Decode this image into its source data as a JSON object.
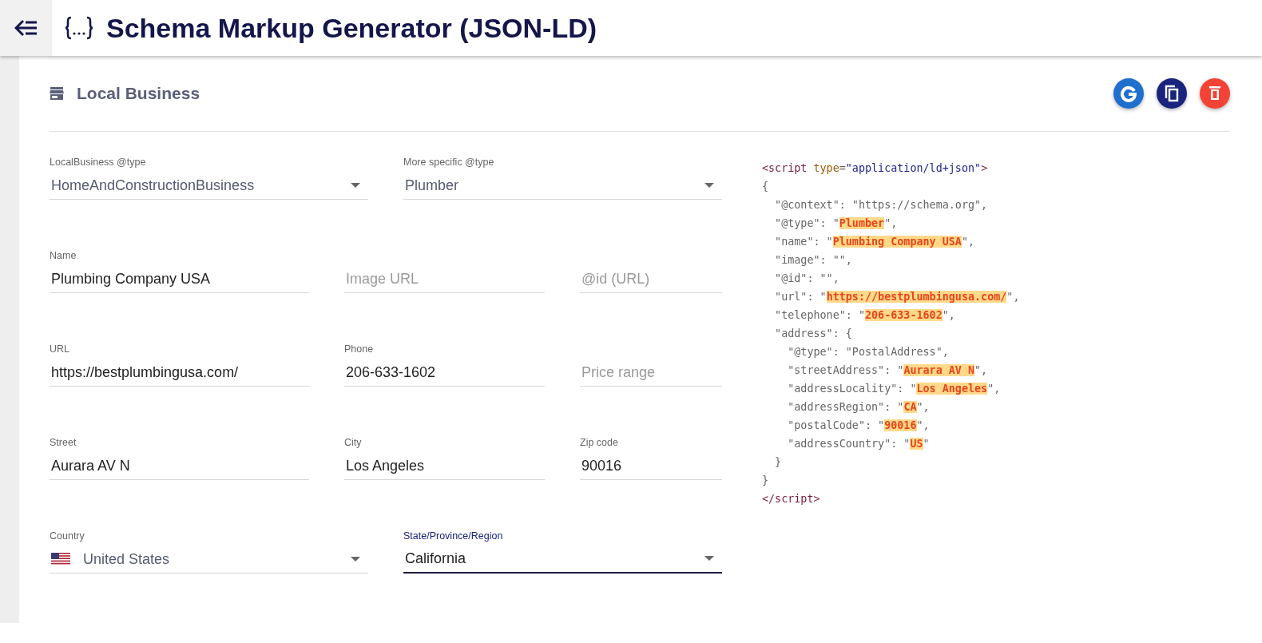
{
  "header": {
    "title": "Schema Markup Generator (JSON-LD)"
  },
  "section": {
    "title": "Local Business",
    "actions": [
      {
        "kind": "google",
        "color": "#1e6fce"
      },
      {
        "kind": "copy",
        "color": "#1a237e"
      },
      {
        "kind": "delete",
        "color": "#f44336"
      }
    ]
  },
  "form_rows": [
    {
      "fields": [
        {
          "kind": "select",
          "label": "LocalBusiness @type",
          "value": "HomeAndConstructionBusiness",
          "focused": false
        },
        {
          "kind": "select",
          "label": "More specific @type",
          "value": "Plumber",
          "focused": false
        }
      ]
    },
    {
      "fields": [
        {
          "kind": "text",
          "label": "Name",
          "value": "Plumbing Company USA"
        },
        {
          "kind": "text",
          "placeholder": "Image URL"
        },
        {
          "kind": "text",
          "placeholder": "@id (URL)"
        }
      ]
    },
    {
      "fields": [
        {
          "kind": "text",
          "label": "URL",
          "value": "https://bestplumbingusa.com/"
        },
        {
          "kind": "text",
          "label": "Phone",
          "value": "206-633-1602"
        },
        {
          "kind": "text",
          "placeholder": "Price range"
        }
      ]
    },
    {
      "fields": [
        {
          "kind": "text",
          "label": "Street",
          "value": "Aurara AV N"
        },
        {
          "kind": "text",
          "label": "City",
          "value": "Los Angeles"
        },
        {
          "kind": "text",
          "label": "Zip code",
          "value": "90016"
        }
      ]
    },
    {
      "fields": [
        {
          "kind": "flag-select",
          "label": "Country",
          "value": "United States",
          "focused": false
        },
        {
          "kind": "select",
          "label": "State/Province/Region",
          "value": "California",
          "focused": true
        }
      ]
    }
  ],
  "code_lines": [
    [
      {
        "kind": "tag",
        "text": "<script "
      },
      {
        "kind": "attr",
        "text": "type"
      },
      {
        "kind": "plain",
        "text": "="
      },
      {
        "kind": "string",
        "text": "\"application/ld+json\""
      },
      {
        "kind": "tag",
        "text": ">"
      }
    ],
    [
      {
        "kind": "plain",
        "text": "{"
      }
    ],
    [
      {
        "kind": "plain",
        "text": "  \"@context\": \"https://schema.org\","
      }
    ],
    [
      {
        "kind": "plain",
        "text": "  \"@type\": \""
      },
      {
        "kind": "value",
        "text": "Plumber"
      },
      {
        "kind": "plain",
        "text": "\","
      }
    ],
    [
      {
        "kind": "plain",
        "text": "  \"name\": \""
      },
      {
        "kind": "value",
        "text": "Plumbing Company USA"
      },
      {
        "kind": "plain",
        "text": "\","
      }
    ],
    [
      {
        "kind": "plain",
        "text": "  \"image\": \"\","
      }
    ],
    [
      {
        "kind": "plain",
        "text": "  \"@id\": \"\","
      }
    ],
    [
      {
        "kind": "plain",
        "text": "  \"url\": \""
      },
      {
        "kind": "value",
        "text": "https://bestplumbingusa.com/"
      },
      {
        "kind": "plain",
        "text": "\","
      }
    ],
    [
      {
        "kind": "plain",
        "text": "  \"telephone\": \""
      },
      {
        "kind": "value",
        "text": "206-633-1602"
      },
      {
        "kind": "plain",
        "text": "\","
      }
    ],
    [
      {
        "kind": "plain",
        "text": "  \"address\": {"
      }
    ],
    [
      {
        "kind": "plain",
        "text": "    \"@type\": \"PostalAddress\","
      }
    ],
    [
      {
        "kind": "plain",
        "text": "    \"streetAddress\": \""
      },
      {
        "kind": "value",
        "text": "Aurara AV N"
      },
      {
        "kind": "plain",
        "text": "\","
      }
    ],
    [
      {
        "kind": "plain",
        "text": "    \"addressLocality\": \""
      },
      {
        "kind": "value",
        "text": "Los Angeles"
      },
      {
        "kind": "plain",
        "text": "\","
      }
    ],
    [
      {
        "kind": "plain",
        "text": "    \"addressRegion\": \""
      },
      {
        "kind": "value",
        "text": "CA"
      },
      {
        "kind": "plain",
        "text": "\","
      }
    ],
    [
      {
        "kind": "plain",
        "text": "    \"postalCode\": \""
      },
      {
        "kind": "value",
        "text": "90016"
      },
      {
        "kind": "plain",
        "text": "\","
      }
    ],
    [
      {
        "kind": "plain",
        "text": "    \"addressCountry\": \""
      },
      {
        "kind": "value",
        "text": "US"
      },
      {
        "kind": "plain",
        "text": "\""
      }
    ],
    [
      {
        "kind": "plain",
        "text": "  }"
      }
    ],
    [
      {
        "kind": "plain",
        "text": "}"
      }
    ],
    [
      {
        "kind": "tag",
        "text": "</script>"
      }
    ]
  ]
}
